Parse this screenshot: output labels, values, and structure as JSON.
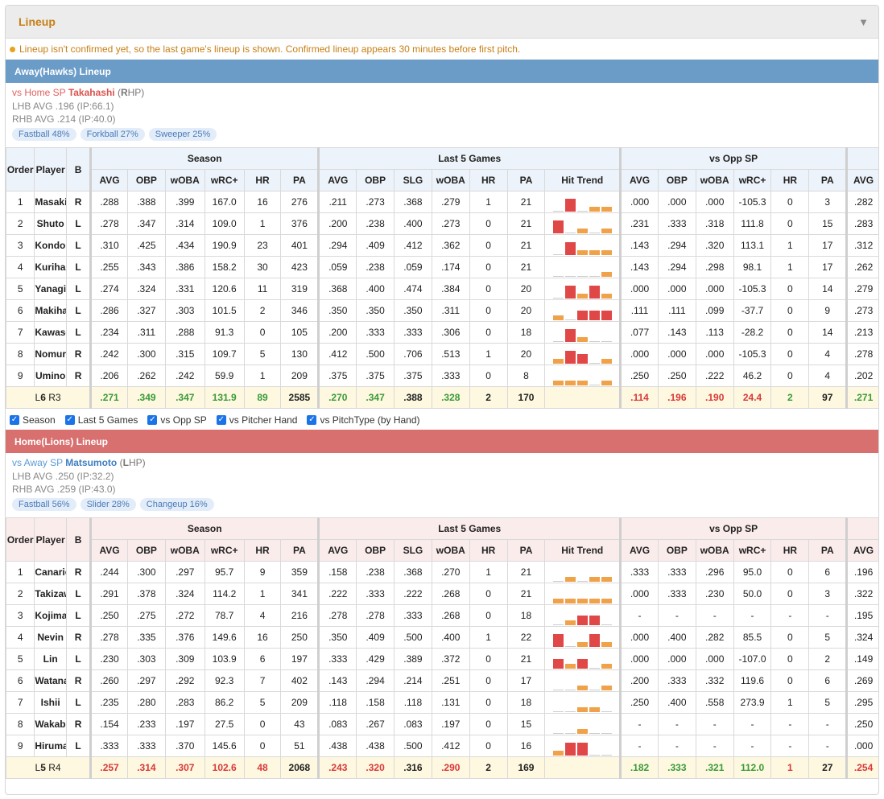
{
  "header": {
    "title": "Lineup",
    "collapse_icon": "triangle-down-icon"
  },
  "notice": "Lineup isn't confirmed yet, so the last game's lineup is shown. Confirmed lineup appears 30 minutes before first pitch.",
  "colors": {
    "away": "#6b9cc8",
    "home": "#d97070",
    "accent": "#c77f16",
    "green": "#3a9a3a",
    "red": "#d9383a"
  },
  "toggles": [
    {
      "label": "Season",
      "checked": true
    },
    {
      "label": "Last 5 Games",
      "checked": true
    },
    {
      "label": "vs Opp SP",
      "checked": true
    },
    {
      "label": "vs Pitcher Hand",
      "checked": true
    },
    {
      "label": "vs PitchType (by Hand)",
      "checked": true
    }
  ],
  "columns": {
    "order": "Order",
    "player": "Player",
    "b": "B",
    "groups": [
      "Season",
      "Last 5 Games",
      "vs Opp SP"
    ],
    "season": [
      "AVG",
      "OBP",
      "wOBA",
      "wRC+",
      "HR",
      "PA"
    ],
    "last5": [
      "AVG",
      "OBP",
      "SLG",
      "wOBA",
      "HR",
      "PA",
      "Hit Trend"
    ],
    "opp": [
      "AVG",
      "OBP",
      "wOBA",
      "wRC+",
      "HR",
      "PA"
    ],
    "extra": "AVG"
  },
  "away": {
    "title": "Away(Hawks) Lineup",
    "sp": {
      "prefix": "vs Home SP ",
      "name": "Takahashi",
      "hand_open": " (",
      "hand_letter": "R",
      "hand_rest": "HP)"
    },
    "lhb": "LHB AVG .196 (IP:66.1)",
    "rhb": "RHB AVG .214 (IP:40.0)",
    "pitches": [
      "Fastball 48%",
      "Forkball 27%",
      "Sweeper 25%"
    ],
    "rows": [
      {
        "o": "1",
        "p": "Masaki",
        "b": "R",
        "s": [
          ".288",
          ".388",
          ".399",
          "167.0",
          "16",
          "276"
        ],
        "l": [
          ".211",
          ".273",
          ".368",
          ".279",
          "1",
          "21"
        ],
        "t": [
          "nb",
          "hi",
          "nb",
          "lo",
          "lo"
        ],
        "v": [
          ".000",
          ".000",
          ".000",
          "-105.3",
          "0",
          "3"
        ],
        "x": ".282"
      },
      {
        "o": "2",
        "p": "Shuto",
        "b": "L",
        "s": [
          ".278",
          ".347",
          ".314",
          "109.0",
          "1",
          "376"
        ],
        "l": [
          ".200",
          ".238",
          ".400",
          ".273",
          "0",
          "21"
        ],
        "t": [
          "hi",
          "nb",
          "lo",
          "nb",
          "lo"
        ],
        "v": [
          ".231",
          ".333",
          ".318",
          "111.8",
          "0",
          "15"
        ],
        "x": ".283"
      },
      {
        "o": "3",
        "p": "Kondoh",
        "b": "L",
        "s": [
          ".310",
          ".425",
          ".434",
          "190.9",
          "23",
          "401"
        ],
        "l": [
          ".294",
          ".409",
          ".412",
          ".362",
          "0",
          "21"
        ],
        "t": [
          "nb",
          "hi",
          "lo",
          "lo",
          "lo"
        ],
        "v": [
          ".143",
          ".294",
          ".320",
          "113.1",
          "1",
          "17"
        ],
        "x": ".312"
      },
      {
        "o": "4",
        "p": "Kurihara",
        "b": "L",
        "s": [
          ".255",
          ".343",
          ".386",
          "158.2",
          "30",
          "423"
        ],
        "l": [
          ".059",
          ".238",
          ".059",
          ".174",
          "0",
          "21"
        ],
        "t": [
          "nb",
          "nb",
          "nb",
          "nb",
          "lo"
        ],
        "v": [
          ".143",
          ".294",
          ".298",
          "98.1",
          "1",
          "17"
        ],
        "x": ".262"
      },
      {
        "o": "5",
        "p": "Yanagita",
        "b": "L",
        "s": [
          ".274",
          ".324",
          ".331",
          "120.6",
          "11",
          "319"
        ],
        "l": [
          ".368",
          ".400",
          ".474",
          ".384",
          "0",
          "20"
        ],
        "t": [
          "nb",
          "hi",
          "lo",
          "hi",
          "lo"
        ],
        "v": [
          ".000",
          ".000",
          ".000",
          "-105.3",
          "0",
          "14"
        ],
        "x": ".279"
      },
      {
        "o": "6",
        "p": "Makihara",
        "b": "L",
        "s": [
          ".286",
          ".327",
          ".303",
          "101.5",
          "2",
          "346"
        ],
        "l": [
          ".350",
          ".350",
          ".350",
          ".311",
          "0",
          "20"
        ],
        "t": [
          "lo",
          "nb",
          "mid",
          "mid",
          "mid"
        ],
        "v": [
          ".111",
          ".111",
          ".099",
          "-37.7",
          "0",
          "9"
        ],
        "x": ".273"
      },
      {
        "o": "7",
        "p": "Kawase",
        "b": "L",
        "s": [
          ".234",
          ".311",
          ".288",
          "91.3",
          "0",
          "105"
        ],
        "l": [
          ".200",
          ".333",
          ".333",
          ".306",
          "0",
          "18"
        ],
        "t": [
          "nb",
          "hi",
          "lo",
          "nb",
          "nb"
        ],
        "v": [
          ".077",
          ".143",
          ".113",
          "-28.2",
          "0",
          "14"
        ],
        "x": ".213"
      },
      {
        "o": "8",
        "p": "Nomura",
        "b": "R",
        "s": [
          ".242",
          ".300",
          ".315",
          "109.7",
          "5",
          "130"
        ],
        "l": [
          ".412",
          ".500",
          ".706",
          ".513",
          "1",
          "20"
        ],
        "t": [
          "lo",
          "hi",
          "mid",
          "nb",
          "lo"
        ],
        "v": [
          ".000",
          ".000",
          ".000",
          "-105.3",
          "0",
          "4"
        ],
        "x": ".278"
      },
      {
        "o": "9",
        "p": "Umino",
        "b": "R",
        "s": [
          ".206",
          ".262",
          ".242",
          "59.9",
          "1",
          "209"
        ],
        "l": [
          ".375",
          ".375",
          ".375",
          ".333",
          "0",
          "8"
        ],
        "t": [
          "lo",
          "lo",
          "lo",
          "nb",
          "lo"
        ],
        "v": [
          ".250",
          ".250",
          ".222",
          "46.2",
          "0",
          "4"
        ],
        "x": ".202"
      }
    ],
    "total": {
      "L": "L",
      "Lv": "6",
      "R": " R",
      "Rv": "3",
      "s": [
        ".271",
        ".349",
        ".347",
        "131.9",
        "89",
        "2585"
      ],
      "l": [
        ".270",
        ".347",
        ".388",
        ".328",
        "2",
        "170"
      ],
      "v": [
        ".114",
        ".196",
        ".190",
        "24.4",
        "2",
        "97"
      ],
      "x": ".271"
    }
  },
  "home": {
    "title": "Home(Lions) Lineup",
    "sp": {
      "prefix": "vs Away SP ",
      "name": "Matsumoto",
      "hand_open": " (",
      "hand_letter": "L",
      "hand_rest": "HP)"
    },
    "lhb": "LHB AVG .250 (IP:32.2)",
    "rhb": "RHB AVG .259 (IP:43.0)",
    "pitches": [
      "Fastball 56%",
      "Slider 28%",
      "Changeup 16%"
    ],
    "rows": [
      {
        "o": "1",
        "p": "Canario",
        "b": "R",
        "s": [
          ".244",
          ".300",
          ".297",
          "95.7",
          "9",
          "359"
        ],
        "l": [
          ".158",
          ".238",
          ".368",
          ".270",
          "1",
          "21"
        ],
        "t": [
          "nb",
          "lo",
          "nb",
          "lo",
          "lo"
        ],
        "v": [
          ".333",
          ".333",
          ".296",
          "95.0",
          "0",
          "6"
        ],
        "x": ".196"
      },
      {
        "o": "2",
        "p": "Takizawa",
        "b": "L",
        "s": [
          ".291",
          ".378",
          ".324",
          "114.2",
          "1",
          "341"
        ],
        "l": [
          ".222",
          ".333",
          ".222",
          ".268",
          "0",
          "21"
        ],
        "t": [
          "lo",
          "lo",
          "lo",
          "lo",
          "lo"
        ],
        "v": [
          ".000",
          ".333",
          ".230",
          "50.0",
          "0",
          "3"
        ],
        "x": ".322"
      },
      {
        "o": "3",
        "p": "Kojima",
        "b": "L",
        "s": [
          ".250",
          ".275",
          ".272",
          "78.7",
          "4",
          "216"
        ],
        "l": [
          ".278",
          ".278",
          ".333",
          ".268",
          "0",
          "18"
        ],
        "t": [
          "nb",
          "lo",
          "mid",
          "mid",
          "nb"
        ],
        "v": [
          "-",
          "-",
          "-",
          "-",
          "-",
          "-"
        ],
        "x": ".195"
      },
      {
        "o": "4",
        "p": "Nevin",
        "b": "R",
        "s": [
          ".278",
          ".335",
          ".376",
          "149.6",
          "16",
          "250"
        ],
        "l": [
          ".350",
          ".409",
          ".500",
          ".400",
          "1",
          "22"
        ],
        "t": [
          "hi",
          "nb",
          "lo",
          "hi",
          "lo"
        ],
        "v": [
          ".000",
          ".400",
          ".282",
          "85.5",
          "0",
          "5"
        ],
        "x": ".324"
      },
      {
        "o": "5",
        "p": "Lin",
        "b": "L",
        "s": [
          ".230",
          ".303",
          ".309",
          "103.9",
          "6",
          "197"
        ],
        "l": [
          ".333",
          ".429",
          ".389",
          ".372",
          "0",
          "21"
        ],
        "t": [
          "mid",
          "lo",
          "mid",
          "nb",
          "lo"
        ],
        "v": [
          ".000",
          ".000",
          ".000",
          "-107.0",
          "0",
          "2"
        ],
        "x": ".149"
      },
      {
        "o": "6",
        "p": "Watanabe",
        "b": "R",
        "s": [
          ".260",
          ".297",
          ".292",
          "92.3",
          "7",
          "402"
        ],
        "l": [
          ".143",
          ".294",
          ".214",
          ".251",
          "0",
          "17"
        ],
        "t": [
          "nb",
          "nb",
          "lo",
          "nb",
          "lo"
        ],
        "v": [
          ".200",
          ".333",
          ".332",
          "119.6",
          "0",
          "6"
        ],
        "x": ".269"
      },
      {
        "o": "7",
        "p": "Ishii",
        "b": "L",
        "s": [
          ".235",
          ".280",
          ".283",
          "86.2",
          "5",
          "209"
        ],
        "l": [
          ".118",
          ".158",
          ".118",
          ".131",
          "0",
          "18"
        ],
        "t": [
          "nb",
          "nb",
          "lo",
          "lo",
          "nb"
        ],
        "v": [
          ".250",
          ".400",
          ".558",
          "273.9",
          "1",
          "5"
        ],
        "x": ".295"
      },
      {
        "o": "8",
        "p": "Wakabaya...",
        "b": "R",
        "s": [
          ".154",
          ".233",
          ".197",
          "27.5",
          "0",
          "43"
        ],
        "l": [
          ".083",
          ".267",
          ".083",
          ".197",
          "0",
          "15"
        ],
        "t": [
          "nb",
          "nb",
          "lo",
          "nb",
          "nb"
        ],
        "v": [
          "-",
          "-",
          "-",
          "-",
          "-",
          "-"
        ],
        "x": ".250"
      },
      {
        "o": "9",
        "p": "Hiruma",
        "b": "L",
        "s": [
          ".333",
          ".333",
          ".370",
          "145.6",
          "0",
          "51"
        ],
        "l": [
          ".438",
          ".438",
          ".500",
          ".412",
          "0",
          "16"
        ],
        "t": [
          "lo",
          "hi",
          "hi",
          "nb",
          "nb"
        ],
        "v": [
          "-",
          "-",
          "-",
          "-",
          "-",
          "-"
        ],
        "x": ".000"
      }
    ],
    "total": {
      "L": "L",
      "Lv": "5",
      "R": " R",
      "Rv": "4",
      "s": [
        ".257",
        ".314",
        ".307",
        "102.6",
        "48",
        "2068"
      ],
      "l": [
        ".243",
        ".320",
        ".316",
        ".290",
        "2",
        "169"
      ],
      "v": [
        ".182",
        ".333",
        ".321",
        "112.0",
        "1",
        "27"
      ],
      "x": ".254"
    }
  }
}
